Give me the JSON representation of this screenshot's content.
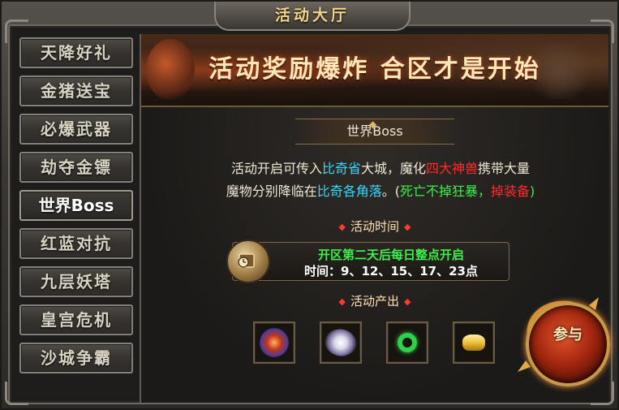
{
  "window": {
    "title": "活动大厅",
    "close_label": "×"
  },
  "sidebar": {
    "items": [
      {
        "label": "天降好礼",
        "active": false
      },
      {
        "label": "金猪送宝",
        "active": false
      },
      {
        "label": "必爆武器",
        "active": false
      },
      {
        "label": "劫夺金镖",
        "active": false
      },
      {
        "label": "世界Boss",
        "active": true
      },
      {
        "label": "红蓝对抗",
        "active": false
      },
      {
        "label": "九层妖塔",
        "active": false
      },
      {
        "label": "皇宫危机",
        "active": false
      },
      {
        "label": "沙城争霸",
        "active": false
      }
    ]
  },
  "banner": {
    "text": "活动奖励爆炸  合区才是开始"
  },
  "section": {
    "title": "世界Boss"
  },
  "description": {
    "line1_a": "活动开启可传入",
    "line1_b": "比奇省",
    "line1_c": "大城，魔化",
    "line1_d": "四大神兽",
    "line1_e": "携带大量",
    "line2_a": "魔物分别降临在",
    "line2_b": "比奇各角落",
    "line2_c": "。(",
    "line2_d": "死亡不掉狂暴，",
    "line2_e": "掉装备",
    "line2_f": ")"
  },
  "time": {
    "heading": "活动时间",
    "line1": "开区第二天后每日整点开启",
    "line2": "时间：9、12、15、17、23点"
  },
  "rewards": {
    "heading": "活动产出",
    "items": [
      {
        "icon": "fire-gem-icon"
      },
      {
        "icon": "white-feather-icon"
      },
      {
        "icon": "jade-ring-icon"
      },
      {
        "icon": "gold-ingot-icon"
      }
    ]
  },
  "join": {
    "label": "参与"
  },
  "colors": {
    "cyan": "#36d7ff",
    "red": "#ff2b2b",
    "green": "#3bf04b",
    "title_gold": "#f3d58a"
  }
}
